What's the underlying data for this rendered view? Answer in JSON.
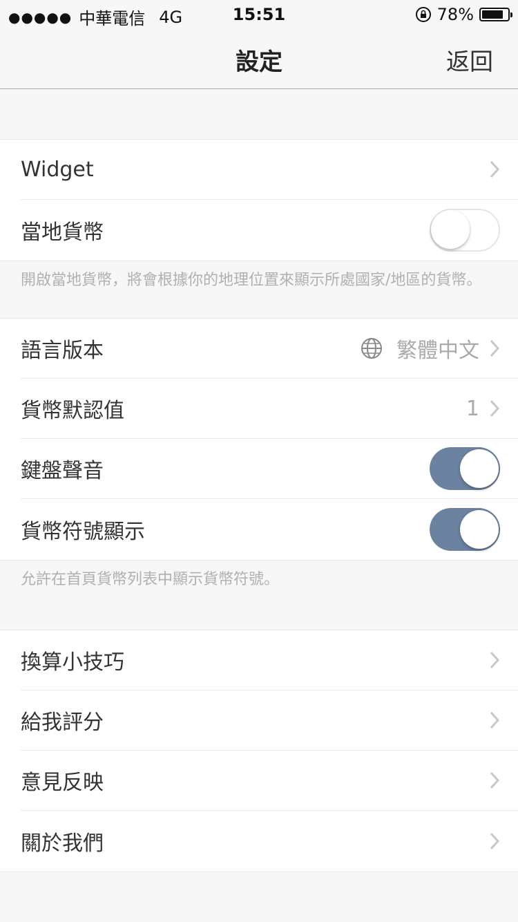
{
  "status_bar": {
    "signal": "●●●●●",
    "carrier": "中華電信",
    "network": "4G",
    "time": "15:51",
    "battery": "78%",
    "battery_level": 0.78
  },
  "nav": {
    "title": "設定",
    "back": "返回"
  },
  "group1": {
    "widget": "Widget",
    "local_currency": "當地貨幣",
    "local_currency_on": false,
    "footnote": "開啟當地貨幣，將會根據你的地理位置來顯示所處國家/地區的貨幣。"
  },
  "group2": {
    "language": "語言版本",
    "language_value": "繁體中文",
    "default_value": "貨幣默認值",
    "default_value_value": "1",
    "keyboard_sound": "鍵盤聲音",
    "keyboard_sound_on": true,
    "symbol_display": "貨幣符號顯示",
    "symbol_display_on": true,
    "footnote": "允許在首頁貨幣列表中顯示貨幣符號。"
  },
  "group3": {
    "tips": "換算小技巧",
    "rate": "給我評分",
    "feedback": "意見反映",
    "about": "關於我們"
  },
  "colors": {
    "toggle_on": "#6b83a0",
    "background": "#f7f7f7"
  }
}
